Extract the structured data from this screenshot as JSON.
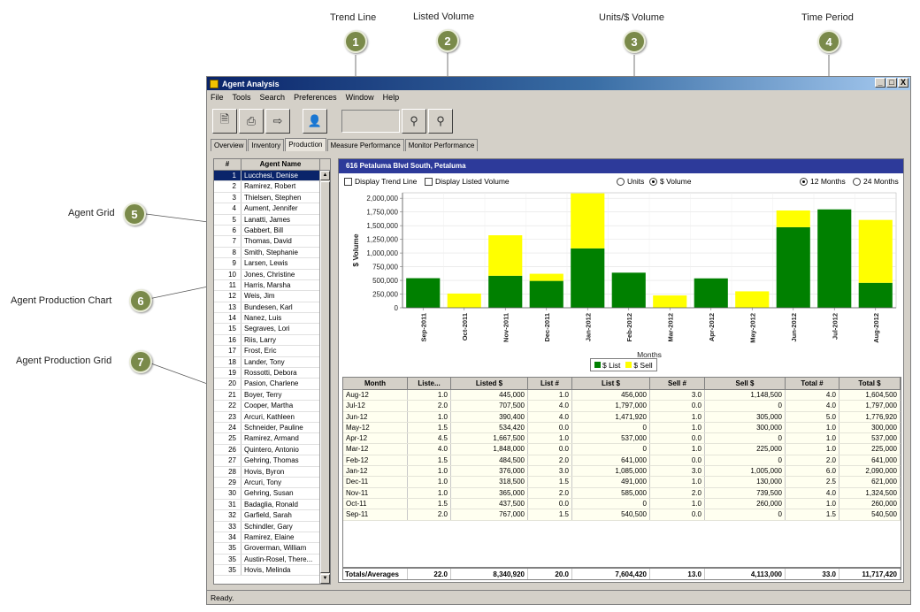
{
  "callouts": [
    {
      "num": "1",
      "label": "Trend Line"
    },
    {
      "num": "2",
      "label": "Listed Volume"
    },
    {
      "num": "3",
      "label": "Units/$ Volume"
    },
    {
      "num": "4",
      "label": "Time Period"
    },
    {
      "num": "5",
      "label": "Agent Grid"
    },
    {
      "num": "6",
      "label": "Agent Production Chart"
    },
    {
      "num": "7",
      "label": "Agent Production Grid"
    }
  ],
  "window": {
    "title": "Agent Analysis",
    "minimize": "_",
    "maximize": "□",
    "close": "X"
  },
  "menu": [
    "File",
    "Tools",
    "Search",
    "Preferences",
    "Window",
    "Help"
  ],
  "toolbar": {
    "icons": [
      "document-icon",
      "print-icon",
      "export-icon",
      "user-search-icon",
      "binoculars-icon",
      "binoculars-next-icon"
    ]
  },
  "tabs": [
    "Overview",
    "Inventory",
    "Production",
    "Measure Performance",
    "Monitor Performance"
  ],
  "agent_grid": {
    "headers": [
      "#",
      "Agent Name"
    ],
    "rows": [
      [
        "1",
        "Lucchesi, Denise"
      ],
      [
        "2",
        "Ramirez, Robert"
      ],
      [
        "3",
        "Thielsen, Stephen"
      ],
      [
        "4",
        "Aument, Jennifer"
      ],
      [
        "5",
        "Lanatti, James"
      ],
      [
        "6",
        "Gabbert, Bill"
      ],
      [
        "7",
        "Thomas, David"
      ],
      [
        "8",
        "Smith, Stephanie"
      ],
      [
        "9",
        "Larsen, Lewis"
      ],
      [
        "10",
        "Jones, Christine"
      ],
      [
        "11",
        "Harris, Marsha"
      ],
      [
        "12",
        "Weis, Jim"
      ],
      [
        "13",
        "Bundesen, Karl"
      ],
      [
        "14",
        "Nanez, Luis"
      ],
      [
        "15",
        "Segraves, Lori"
      ],
      [
        "16",
        "Riis, Larry"
      ],
      [
        "17",
        "Frost, Eric"
      ],
      [
        "18",
        "Lander, Tony"
      ],
      [
        "19",
        "Rossotti, Debora"
      ],
      [
        "20",
        "Pasion, Charlene"
      ],
      [
        "21",
        "Boyer, Terry"
      ],
      [
        "22",
        "Cooper, Martha"
      ],
      [
        "23",
        "Arcuri, Kathleen"
      ],
      [
        "24",
        "Schneider, Pauline"
      ],
      [
        "25",
        "Ramirez, Armand"
      ],
      [
        "26",
        "Quintero, Antonio"
      ],
      [
        "27",
        "Gehring, Thomas"
      ],
      [
        "28",
        "Hovis, Byron"
      ],
      [
        "29",
        "Arcuri, Tony"
      ],
      [
        "30",
        "Gehring, Susan"
      ],
      [
        "31",
        "Badaglia, Ronald"
      ],
      [
        "32",
        "Garfield, Sarah"
      ],
      [
        "33",
        "Schindler, Gary"
      ],
      [
        "34",
        "Ramirez, Elaine"
      ],
      [
        "35",
        "Groverman, William"
      ],
      [
        "35",
        "Austin-Rosel, There..."
      ],
      [
        "35",
        "Hovis, Melinda"
      ]
    ]
  },
  "panel": {
    "title": "616 Petaluma Blvd South, Petaluma",
    "display_trend_line": "Display Trend Line",
    "display_listed_volume": "Display Listed Volume",
    "units_label": "Units",
    "volume_label": "$ Volume",
    "months12_label": "12 Months",
    "months24_label": "24 Months"
  },
  "chart_data": {
    "type": "bar",
    "stacked": true,
    "categories": [
      "Sep-2011",
      "Oct-2011",
      "Nov-2011",
      "Dec-2011",
      "Jan-2012",
      "Feb-2012",
      "Mar-2012",
      "Apr-2012",
      "May-2012",
      "Jun-2012",
      "Jul-2012",
      "Aug-2012"
    ],
    "series": [
      {
        "name": "$ List",
        "color": "#008000",
        "values": [
          540500,
          0,
          585000,
          491000,
          1085000,
          641000,
          0,
          537000,
          0,
          1471920,
          1797000,
          456000
        ]
      },
      {
        "name": "$ Sell",
        "color": "#ffff00",
        "values": [
          0,
          260000,
          739500,
          130000,
          1005000,
          0,
          225000,
          0,
          300000,
          305000,
          0,
          1148500
        ]
      }
    ],
    "ylabel": "$ Volume",
    "xlabel": "Months",
    "ylim": [
      0,
      2100000
    ],
    "yticks": [
      "0",
      "250,000",
      "500,000",
      "750,000",
      "1,000,000",
      "1,250,000",
      "1,500,000",
      "1,750,000",
      "2,000,000"
    ],
    "grid": true,
    "legend": "bottom-center"
  },
  "production_grid": {
    "headers": [
      "Month",
      "Liste...",
      "Listed $",
      "List #",
      "List $",
      "Sell #",
      "Sell $",
      "Total #",
      "Total $"
    ],
    "rows": [
      [
        "Aug-12",
        "1.0",
        "445,000",
        "1.0",
        "456,000",
        "3.0",
        "1,148,500",
        "4.0",
        "1,604,500"
      ],
      [
        "Jul-12",
        "2.0",
        "707,500",
        "4.0",
        "1,797,000",
        "0.0",
        "0",
        "4.0",
        "1,797,000"
      ],
      [
        "Jun-12",
        "1.0",
        "390,400",
        "4.0",
        "1,471,920",
        "1.0",
        "305,000",
        "5.0",
        "1,776,920"
      ],
      [
        "May-12",
        "1.5",
        "534,420",
        "0.0",
        "0",
        "1.0",
        "300,000",
        "1.0",
        "300,000"
      ],
      [
        "Apr-12",
        "4.5",
        "1,667,500",
        "1.0",
        "537,000",
        "0.0",
        "0",
        "1.0",
        "537,000"
      ],
      [
        "Mar-12",
        "4.0",
        "1,848,000",
        "0.0",
        "0",
        "1.0",
        "225,000",
        "1.0",
        "225,000"
      ],
      [
        "Feb-12",
        "1.5",
        "484,500",
        "2.0",
        "641,000",
        "0.0",
        "0",
        "2.0",
        "641,000"
      ],
      [
        "Jan-12",
        "1.0",
        "376,000",
        "3.0",
        "1,085,000",
        "3.0",
        "1,005,000",
        "6.0",
        "2,090,000"
      ],
      [
        "Dec-11",
        "1.0",
        "318,500",
        "1.5",
        "491,000",
        "1.0",
        "130,000",
        "2.5",
        "621,000"
      ],
      [
        "Nov-11",
        "1.0",
        "365,000",
        "2.0",
        "585,000",
        "2.0",
        "739,500",
        "4.0",
        "1,324,500"
      ],
      [
        "Oct-11",
        "1.5",
        "437,500",
        "0.0",
        "0",
        "1.0",
        "260,000",
        "1.0",
        "260,000"
      ],
      [
        "Sep-11",
        "2.0",
        "767,000",
        "1.5",
        "540,500",
        "0.0",
        "0",
        "1.5",
        "540,500"
      ]
    ],
    "totals": [
      "Totals/Averages",
      "22.0",
      "8,340,920",
      "20.0",
      "7,604,420",
      "13.0",
      "4,113,000",
      "33.0",
      "11,717,420"
    ]
  },
  "status": "Ready."
}
